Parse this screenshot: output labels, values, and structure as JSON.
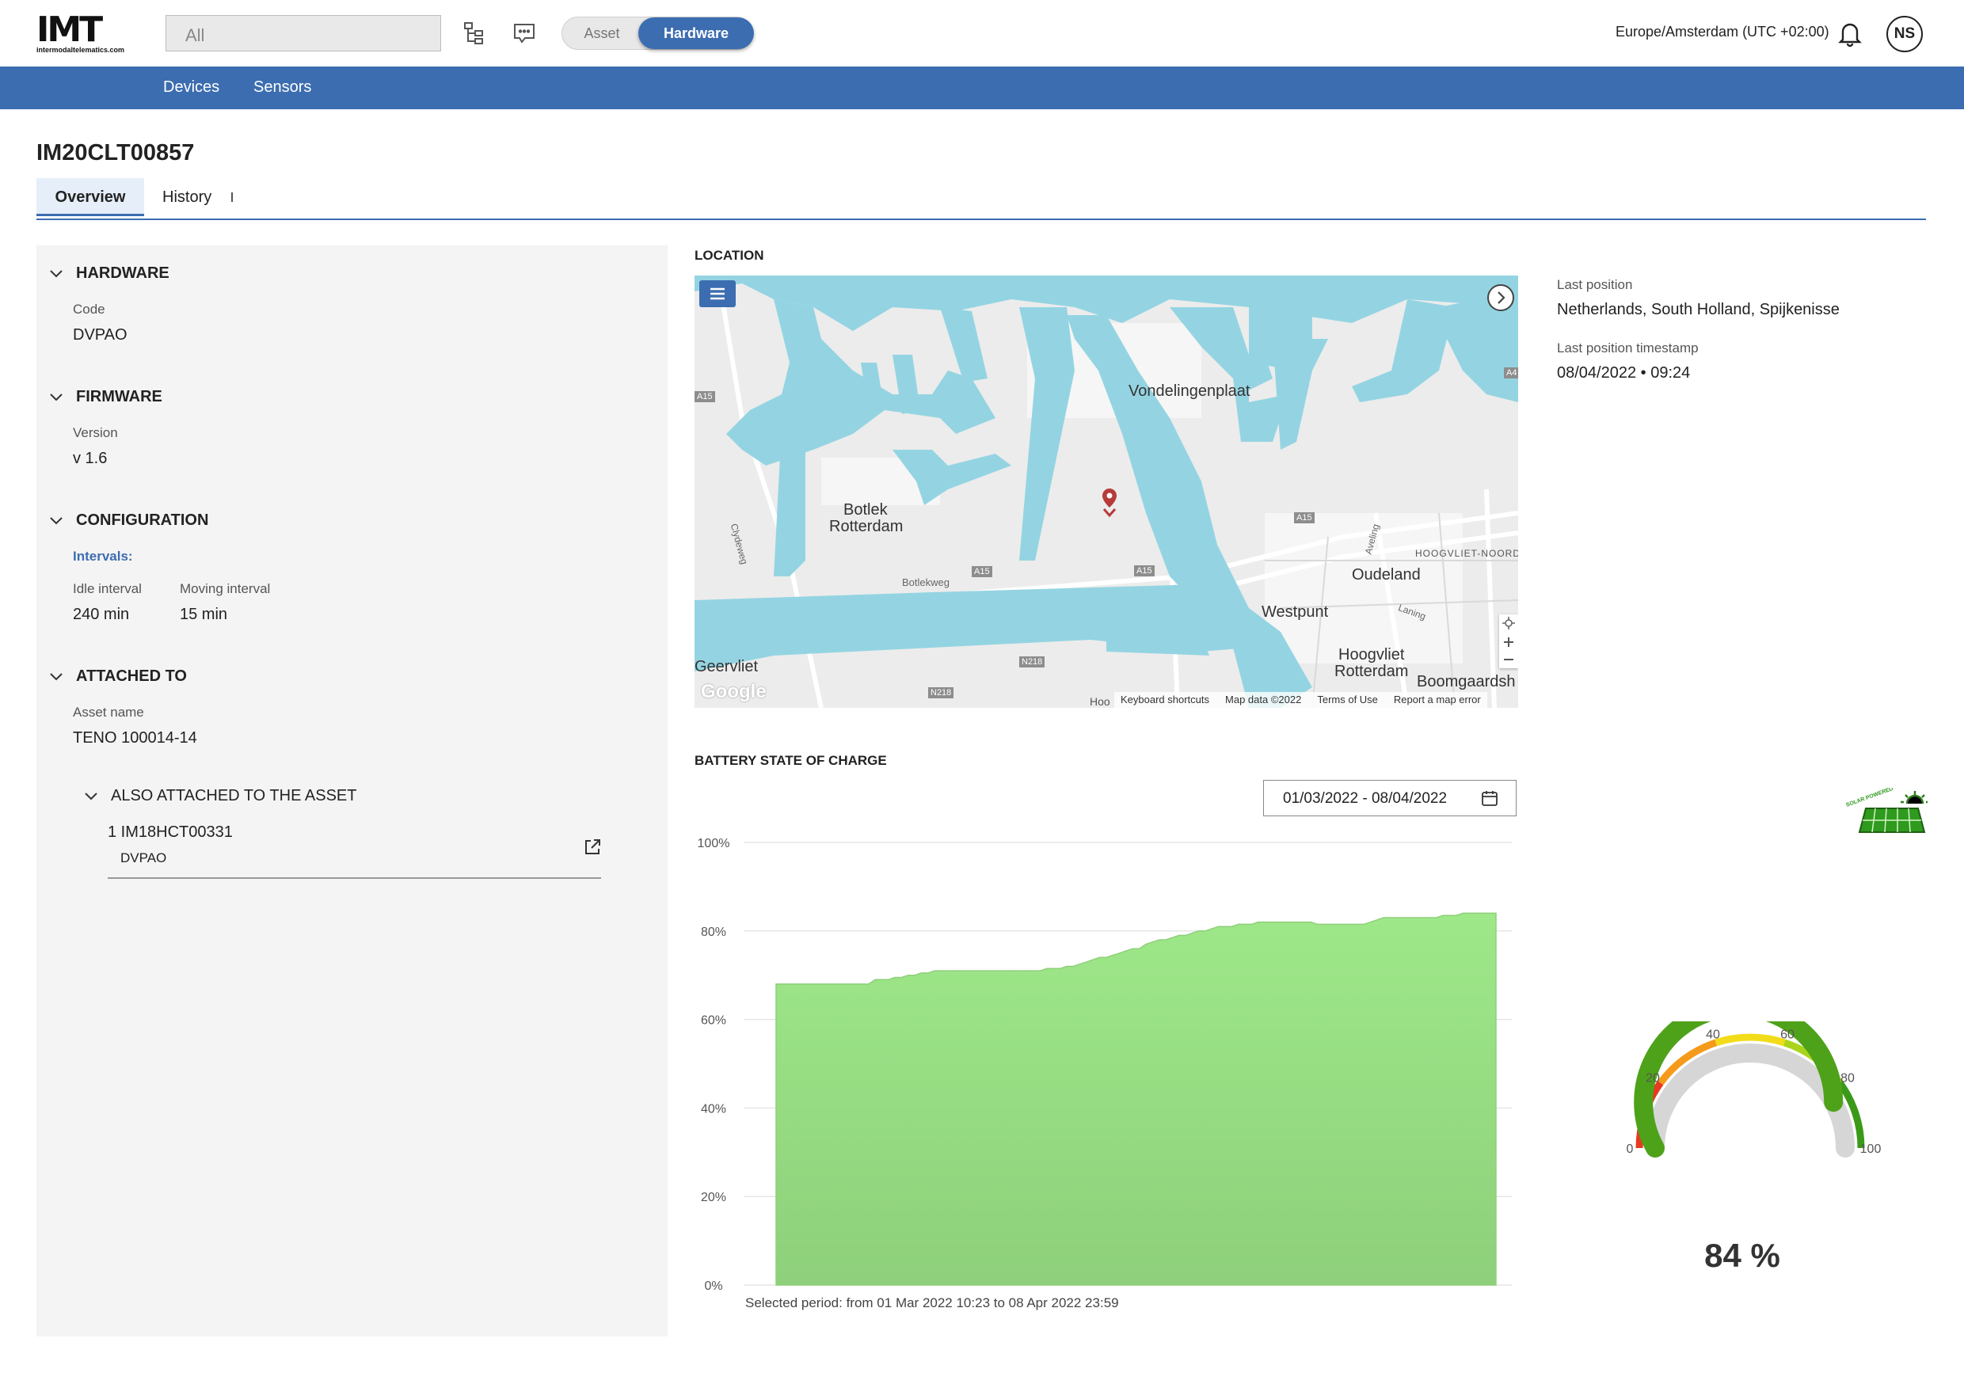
{
  "header": {
    "logo_text": "IMT",
    "logo_sub": "intermodaltelematics.com",
    "search_placeholder": "All",
    "toggle": {
      "asset": "Asset",
      "hardware": "Hardware"
    },
    "timezone": "Europe/Amsterdam (UTC +02:00)",
    "user_initials": "NS"
  },
  "nav": {
    "items": [
      "Devices",
      "Sensors"
    ]
  },
  "device": {
    "id": "IM20CLT00857"
  },
  "tabs": {
    "overview": "Overview",
    "history": "History"
  },
  "hardware": {
    "title": "HARDWARE",
    "code_label": "Code",
    "code": "DVPAO"
  },
  "firmware": {
    "title": "FIRMWARE",
    "version_label": "Version",
    "version": "v 1.6"
  },
  "configuration": {
    "title": "CONFIGURATION",
    "intervals_label": "Intervals:",
    "idle_label": "Idle interval",
    "idle": "240 min",
    "moving_label": "Moving interval",
    "moving": "15 min"
  },
  "attached": {
    "title": "ATTACHED TO",
    "asset_label": "Asset name",
    "asset": "TENO 100014-14",
    "also_title": "ALSO ATTACHED TO THE ASSET",
    "item_name": "1 IM18HCT00331",
    "item_code": "DVPAO"
  },
  "location": {
    "title": "LOCATION",
    "last_pos_label": "Last position",
    "last_pos": "Netherlands, South Holland, Spijkenisse",
    "last_ts_label": "Last position timestamp",
    "last_ts": "08/04/2022 • 09:24",
    "map_labels": {
      "vondelingenplaat": "Vondelingenplaat",
      "botlek1": "Botlek",
      "botlek2": "Rotterdam",
      "oudeland": "Oudeland",
      "westpunt": "Westpunt",
      "hoogvliet1": "Hoogvliet",
      "hoogvliet2": "Rotterdam",
      "geervliet": "Geervliet",
      "boomgaard": "Boomgaardsh",
      "hoogvliet_noord": "HOOGVLIET-NOORD",
      "botlekweg": "Botlekweg",
      "clydeweg": "Clydeweg",
      "aveling": "Aveling",
      "laning": "Laning",
      "a15": "A15",
      "n218": "N218",
      "a4": "A4",
      "hoo": "Hoo"
    },
    "map_footer": {
      "google": "Google",
      "shortcuts": "Keyboard shortcuts",
      "data": "Map data ©2022",
      "terms": "Terms of Use",
      "report": "Report a map error"
    }
  },
  "battery": {
    "title": "BATTERY STATE OF CHARGE",
    "date_range": "01/03/2022 - 08/04/2022",
    "period_text": "Selected period: from 01 Mar 2022 10:23 to 08 Apr 2022 23:59",
    "gauge_value": 84,
    "gauge_text": "84 %",
    "gauge_ticks": [
      "0",
      "20",
      "40",
      "60",
      "80",
      "100"
    ],
    "solar_label": "SOLAR POWERED"
  },
  "chart_data": {
    "type": "area",
    "title": "BATTERY STATE OF CHARGE",
    "ylabel": "",
    "xlabel": "",
    "ylim": [
      0,
      100
    ],
    "ytick_labels": [
      "0%",
      "20%",
      "40%",
      "60%",
      "80%",
      "100%"
    ],
    "grid": true,
    "x_start": "01 Mar 2022 10:23",
    "x_end": "08 Apr 2022 23:59",
    "series": [
      {
        "values": [
          68,
          68,
          68,
          68,
          68,
          68,
          68,
          68,
          68,
          68,
          68,
          68,
          68,
          68,
          68,
          69,
          69,
          69,
          69.5,
          69.5,
          70,
          70,
          70.5,
          70.5,
          71,
          71,
          71,
          71,
          71,
          71,
          71,
          71,
          71,
          71,
          71,
          71,
          71,
          71,
          71,
          71,
          71,
          71.5,
          71.5,
          71.5,
          72,
          72,
          72.5,
          73,
          73.5,
          74,
          74,
          74.5,
          75,
          75.5,
          76,
          76,
          77,
          77.5,
          78,
          78,
          78.5,
          79,
          79,
          79.5,
          80,
          80,
          80.5,
          81,
          81,
          81,
          81.5,
          81.5,
          81.5,
          82,
          82,
          82,
          82,
          82,
          82,
          82,
          82,
          82,
          81.5,
          81.5,
          81.5,
          81.5,
          81.5,
          81.5,
          81.5,
          81.5,
          82,
          82.5,
          83,
          83,
          83,
          83,
          83,
          83,
          83,
          83,
          83,
          83.5,
          83.5,
          83.5,
          84,
          84,
          84,
          84,
          84,
          84
        ]
      }
    ]
  }
}
